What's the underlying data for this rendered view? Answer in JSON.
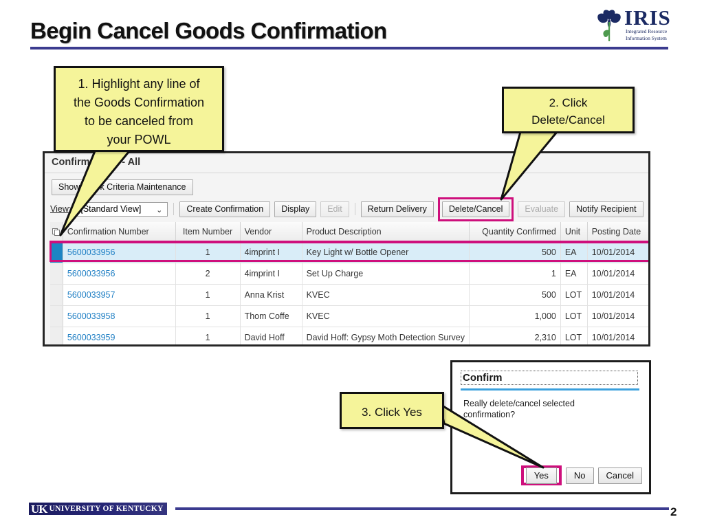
{
  "slide": {
    "title": "Begin Cancel Goods Confirmation",
    "page_number": "2",
    "accent_color": "#3b3b8f",
    "highlight_color": "#ce0f7c",
    "callout_fill": "#f5f49a"
  },
  "iris_logo": {
    "wordmark": "IRIS",
    "subtitle_line1": "Integrated Resource",
    "subtitle_line2": "Information System"
  },
  "uk_logo": {
    "mark": "UK",
    "name": "UNIVERSITY OF KENTUCKY"
  },
  "callouts": [
    {
      "id": "1",
      "line1": "1. Highlight any line of",
      "line2": "the Goods Confirmation",
      "line3": "to be canceled from",
      "line4": "your POWL"
    },
    {
      "id": "2",
      "line1": "2. Click",
      "line2": "Delete/Cancel"
    },
    {
      "id": "3",
      "text": "3. Click Yes"
    }
  ],
  "sap": {
    "title": "Confirmations - All",
    "quick_criteria_button": "Show Quick Criteria Maintenance",
    "view_label": "View:",
    "view_value": "[Standard View]",
    "chevron": "⌄",
    "buttons": [
      {
        "label": "Create Confirmation",
        "disabled": false,
        "highlighted": false
      },
      {
        "label": "Display",
        "disabled": false,
        "highlighted": false
      },
      {
        "label": "Edit",
        "disabled": true,
        "highlighted": false
      },
      {
        "label": "Return Delivery",
        "disabled": false,
        "highlighted": false
      },
      {
        "label": "Delete/Cancel",
        "disabled": false,
        "highlighted": true
      },
      {
        "label": "Evaluate",
        "disabled": true,
        "highlighted": false
      },
      {
        "label": "Notify Recipient",
        "disabled": false,
        "highlighted": false
      }
    ],
    "columns": [
      "Confirmation Number",
      "Item Number",
      "Vendor",
      "Product Description",
      "Quantity Confirmed",
      "Unit",
      "Posting Date"
    ],
    "rows": [
      {
        "confirmation_number": "5600033956",
        "item_number": "1",
        "vendor": "4imprint I",
        "product_description": "Key Light w/ Bottle Opener",
        "quantity_confirmed": "500",
        "unit": "EA",
        "posting_date": "10/01/2014",
        "selected": true
      },
      {
        "confirmation_number": "5600033956",
        "item_number": "2",
        "vendor": "4imprint I",
        "product_description": "Set Up Charge",
        "quantity_confirmed": "1",
        "unit": "EA",
        "posting_date": "10/01/2014",
        "selected": false
      },
      {
        "confirmation_number": "5600033957",
        "item_number": "1",
        "vendor": "Anna Krist",
        "product_description": "KVEC",
        "quantity_confirmed": "500",
        "unit": "LOT",
        "posting_date": "10/01/2014",
        "selected": false
      },
      {
        "confirmation_number": "5600033958",
        "item_number": "1",
        "vendor": "Thom Coffe",
        "product_description": "KVEC",
        "quantity_confirmed": "1,000",
        "unit": "LOT",
        "posting_date": "10/01/2014",
        "selected": false
      },
      {
        "confirmation_number": "5600033959",
        "item_number": "1",
        "vendor": "David Hoff",
        "product_description": "David Hoff: Gypsy Moth Detection Survey",
        "quantity_confirmed": "2,310",
        "unit": "LOT",
        "posting_date": "10/01/2014",
        "selected": false
      }
    ]
  },
  "confirm_dialog": {
    "title": "Confirm",
    "message_line1": "Really delete/cancel selected",
    "message_line2": "confirmation?",
    "buttons": [
      {
        "label": "Yes",
        "highlighted": true
      },
      {
        "label": "No",
        "highlighted": false
      },
      {
        "label": "Cancel",
        "highlighted": false
      }
    ]
  }
}
